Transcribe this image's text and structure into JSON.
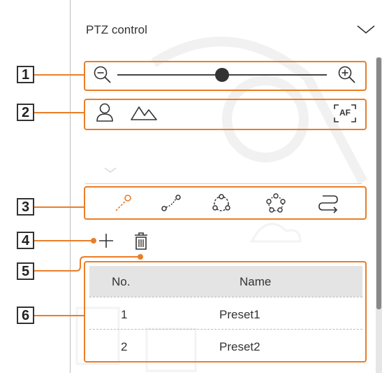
{
  "panel": {
    "title": "PTZ control"
  },
  "callouts": [
    "1",
    "2",
    "3",
    "4",
    "5",
    "6"
  ],
  "zoom": {
    "level": 0.5
  },
  "icons": {
    "collapse": "chevron-down-icon",
    "zoom_out": "zoom-out-icon",
    "zoom_in": "zoom-in-icon",
    "focus_near": "person-icon",
    "focus_far": "mountain-icon",
    "autofocus": "AF",
    "preset": "preset-icon",
    "swing": "swing-icon",
    "group": "group-icon",
    "tour": "tour-icon",
    "trace": "trace-icon",
    "add": "plus-icon",
    "delete": "trash-icon"
  },
  "accent_color": "#ea7e28",
  "table": {
    "columns": [
      "No.",
      "Name"
    ],
    "rows": [
      {
        "no": "1",
        "name": "Preset1"
      },
      {
        "no": "2",
        "name": "Preset2"
      }
    ]
  }
}
